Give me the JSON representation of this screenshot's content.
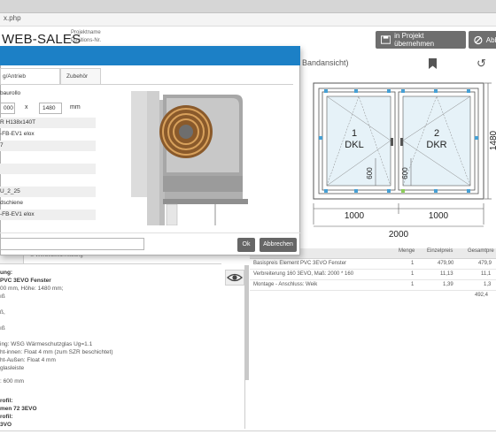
{
  "browser": {
    "url": "x.php"
  },
  "header": {
    "brand": "WEB-SALES",
    "brand_sub1": "Projektname",
    "brand_sub2": "Positions-Nr.",
    "btn_uebernehmen": "in Projekt übernehmen",
    "btn_abbrechen": "Abb",
    "icons": [
      "save-icon",
      "cancel-icon"
    ]
  },
  "drawing": {
    "title": "Bandansicht)",
    "icons": [
      "bookmark-icon",
      "undo-icon"
    ],
    "sash_left_number": "1",
    "sash_left_label": "DKL",
    "sash_right_number": "2",
    "sash_right_label": "DKR",
    "dim_width_left": "1000",
    "dim_width_right": "1000",
    "dim_total_width": "2000",
    "dim_height": "1480",
    "dim_handle_left": "600",
    "dim_handle_right": "600"
  },
  "table": {
    "headers": [
      "",
      "Menge",
      "Einzelpreis",
      "Gesamtpre"
    ],
    "rows": [
      {
        "desc": "Basispreis Element PVC 3EVO Fenster",
        "menge": "1",
        "einzel": "479,90",
        "gesamt": "479,9"
      },
      {
        "desc": "Verbreiterung 160 3EVO, Maß: 2000 * 160",
        "menge": "1",
        "einzel": "11,13",
        "gesamt": "11,1"
      },
      {
        "desc": "Montage - Anschluss: Weik",
        "menge": "1",
        "einzel": "1,39",
        "gesamt": "1,3"
      }
    ],
    "total": "492,4"
  },
  "info": {
    "tab1": "ment",
    "tab2": "U Werbebeschreibung",
    "lines": [
      {
        "text": "ung:",
        "bold": true
      },
      {
        "text": "PVC 3EVO Fenster",
        "bold": true
      },
      {
        "text": "00 mm, Höhe: 1480 mm;",
        "bold": false
      },
      {
        "text": "ıß",
        "bold": false
      },
      {
        "text": "",
        "bold": false
      },
      {
        "text": "ß,",
        "bold": false
      },
      {
        "text": "",
        "bold": false
      },
      {
        "text": "ıß",
        "bold": false
      },
      {
        "text": "",
        "bold": false
      },
      {
        "text": "ing: WSG Wärmeschutzglas Ug=1.1",
        "bold": false
      },
      {
        "text": "ht-innen: Float 4 mm (zum SZR beschichtet)",
        "bold": false
      },
      {
        "text": "ht-Außen: Float 4 mm",
        "bold": false
      },
      {
        "text": "glasleiste",
        "bold": false
      },
      {
        "text": "",
        "bold": false
      },
      {
        "text": ": 600 mm",
        "bold": false
      },
      {
        "text": "",
        "bold": false
      },
      {
        "text": "rofil:",
        "bold": true
      },
      {
        "text": "men 72 3EVO",
        "bold": true
      },
      {
        "text": "rofil:",
        "bold": true
      },
      {
        "text": "3VO",
        "bold": true
      }
    ],
    "icons": [
      "eye-icon"
    ]
  },
  "modal": {
    "tab1": "g/Antrieb",
    "tab2": "Zubehör",
    "rows": [
      {
        "text": "baurollo",
        "shaded": false
      },
      {
        "text": "",
        "shaded": false
      },
      {
        "text": "R H138x140T",
        "shaded": true
      },
      {
        "text": "-FB-EV1 elox",
        "shaded": false
      },
      {
        "text": "7",
        "shaded": true
      },
      {
        "text": "",
        "shaded": false
      },
      {
        "text": "",
        "shaded": true
      },
      {
        "text": "",
        "shaded": false
      },
      {
        "text": "U_2_25",
        "shaded": true
      },
      {
        "text": "dschiene",
        "shaded": false
      },
      {
        "text": "-FB-EV1 elox",
        "shaded": true
      }
    ],
    "input_width": "000",
    "x_label": "x",
    "input_height": "1480",
    "unit": "mm",
    "btn_ok": "Ok",
    "btn_abbrechen": "Abbrechen",
    "image": "roller-shutter-cross-section"
  },
  "colors": {
    "modal_header": "#1c80c6",
    "button": "#666666"
  }
}
